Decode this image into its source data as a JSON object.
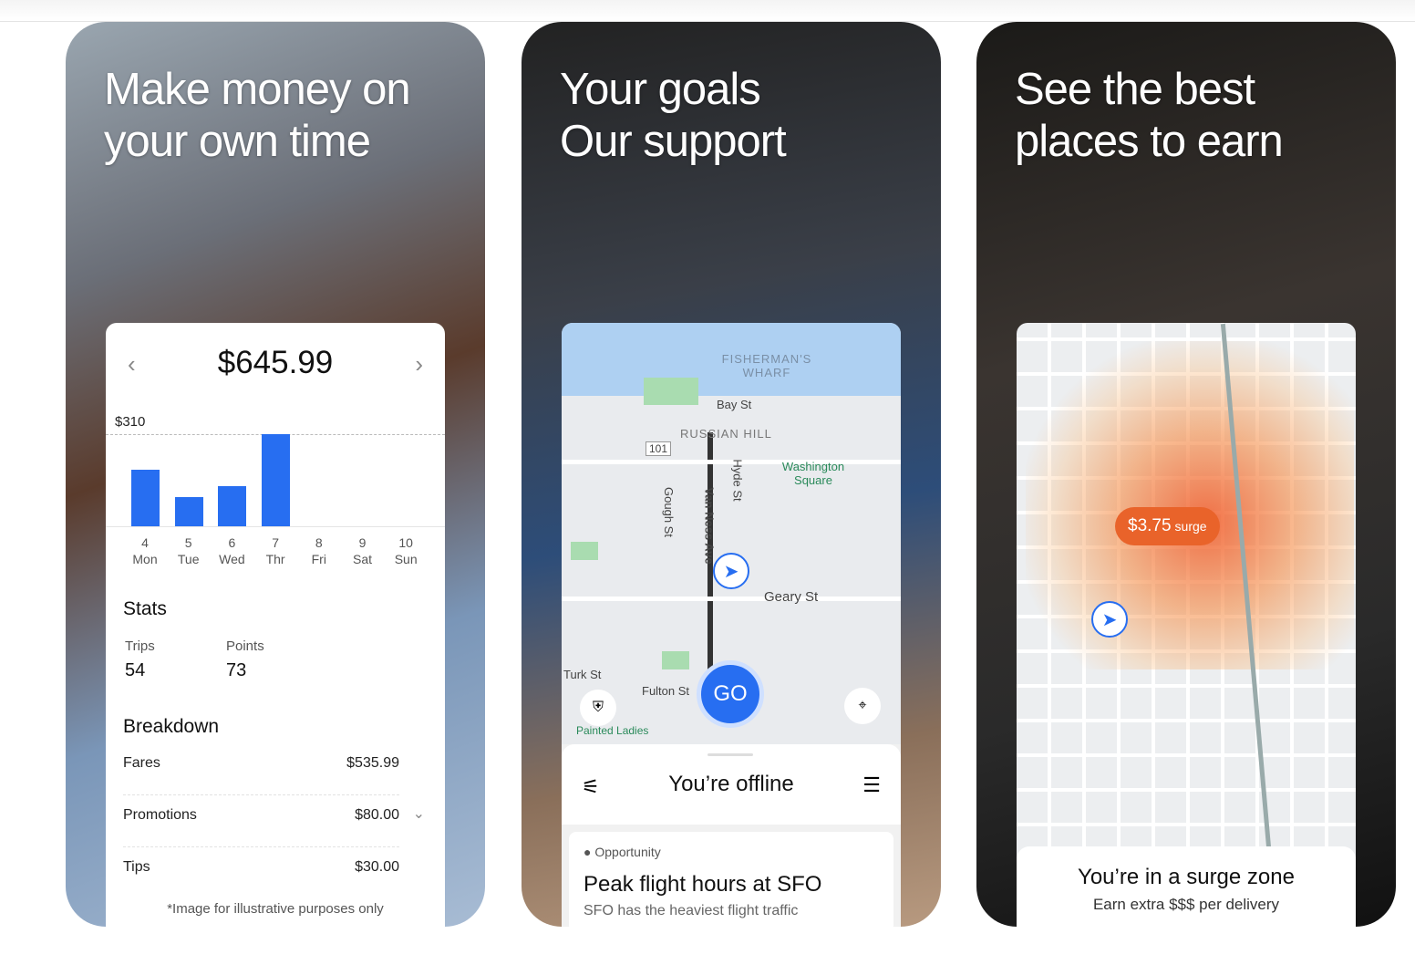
{
  "panels": [
    {
      "headline": [
        "Make money on",
        "your own time"
      ],
      "earnings": {
        "total": "$645.99",
        "ref_label": "$310",
        "ref_value": 310,
        "days": [
          {
            "num": "4",
            "day": "Mon",
            "value": 190
          },
          {
            "num": "5",
            "day": "Tue",
            "value": 98
          },
          {
            "num": "6",
            "day": "Wed",
            "value": 135
          },
          {
            "num": "7",
            "day": "Thr",
            "value": 310
          },
          {
            "num": "8",
            "day": "Fri",
            "value": 0
          },
          {
            "num": "9",
            "day": "Sat",
            "value": 0
          },
          {
            "num": "10",
            "day": "Sun",
            "value": 0
          }
        ],
        "stats_title": "Stats",
        "trips_label": "Trips",
        "trips": "54",
        "points_label": "Points",
        "points": "73",
        "breakdown_title": "Breakdown",
        "breakdown": [
          {
            "label": "Fares",
            "value": "$535.99"
          },
          {
            "label": "Promotions",
            "value": "$80.00"
          },
          {
            "label": "Tips",
            "value": "$30.00"
          }
        ],
        "note": "*Image for illustrative purposes only"
      }
    },
    {
      "headline": [
        "Your goals",
        "Our support"
      ],
      "map": {
        "labels": [
          "FISHERMAN'S WHARF",
          "Bay St",
          "RUSSIAN HILL",
          "Washington Square",
          "Van Ness Ave",
          "Hyde St",
          "Gough St",
          "Geary St",
          "Turk St",
          "Fulton St",
          "Painted Ladies",
          "101"
        ],
        "go": "GO",
        "status": "You’re offline",
        "opp_tag": "Opportunity",
        "opp_title": "Peak flight hours at SFO",
        "opp_text": "SFO has the heaviest flight traffic"
      }
    },
    {
      "headline": [
        "See the best",
        "places to earn"
      ],
      "map": {
        "surge_amount": "$3.75",
        "surge_label": "surge",
        "title": "You’re in a surge zone",
        "subtitle": "Earn extra $$$ per delivery"
      }
    }
  ],
  "colors": {
    "accent": "#276ef1",
    "surge": "#e9632a"
  }
}
